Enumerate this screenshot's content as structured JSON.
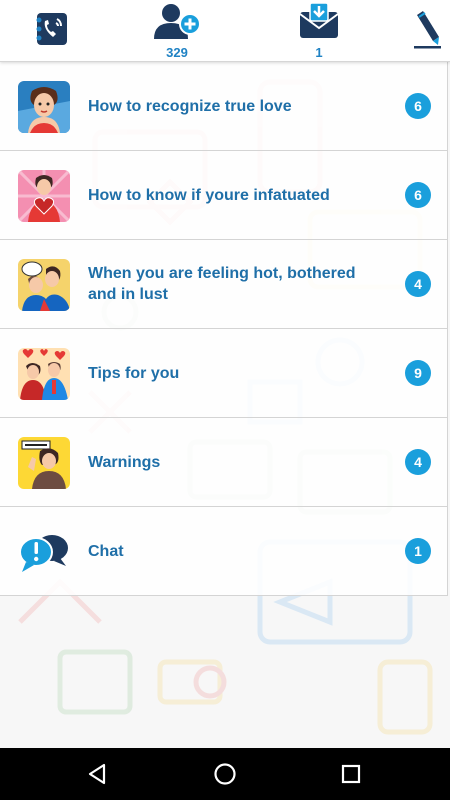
{
  "header": {
    "call_icon": "phone-call-icon",
    "add_user": {
      "icon": "add-user-icon",
      "count": "329"
    },
    "inbox": {
      "icon": "envelope-download-icon",
      "count": "1"
    },
    "edit_icon": "pencil-icon"
  },
  "items": [
    {
      "label": "How to recognize true love",
      "badge": "6",
      "thumb": "woman-thinking-icon"
    },
    {
      "label": "How to know if youre infatuated",
      "badge": "6",
      "thumb": "woman-with-heart-icon"
    },
    {
      "label": "When you are feeling hot, bothered and in lust",
      "badge": "4",
      "thumb": "couple-kissing-icon"
    },
    {
      "label": "Tips for you",
      "badge": "9",
      "thumb": "couple-hearts-icon"
    },
    {
      "label": "Warnings",
      "badge": "4",
      "thumb": "attention-woman-icon"
    },
    {
      "label": "Chat",
      "badge": "1",
      "thumb": "chat-bubbles-icon"
    }
  ],
  "navbar": {
    "back_icon": "back-triangle-icon",
    "home_icon": "home-circle-icon",
    "recents_icon": "recents-square-icon"
  },
  "colors": {
    "accent": "#1a9fdc",
    "label": "#1f6fa8",
    "header_icon": "#1f82c4",
    "navbar": "#000000"
  }
}
